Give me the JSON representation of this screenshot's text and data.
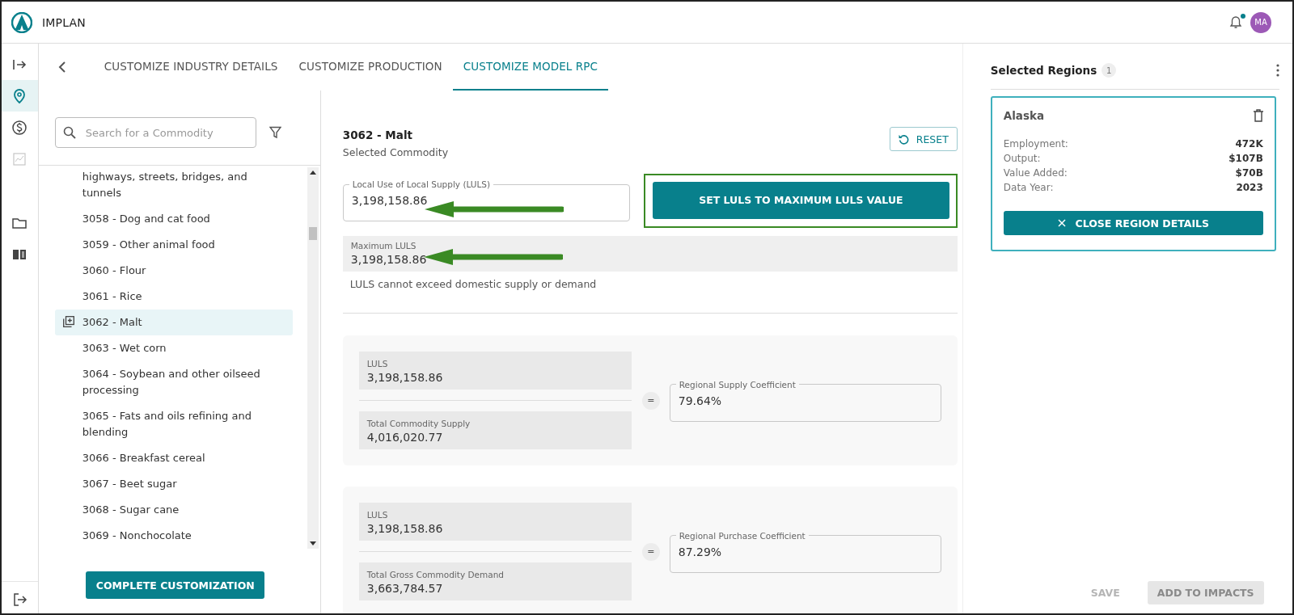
{
  "app": {
    "name": "IMPLAN"
  },
  "header": {
    "notifications_unread": true,
    "avatar": "MA"
  },
  "rail": {
    "items": [
      {
        "kind": "expand",
        "selected": false,
        "disabled": false
      },
      {
        "kind": "location",
        "selected": true,
        "disabled": false
      },
      {
        "kind": "dollar",
        "selected": false,
        "disabled": false
      },
      {
        "kind": "chart",
        "selected": false,
        "disabled": true
      },
      {
        "kind": "folder",
        "selected": false,
        "disabled": false
      },
      {
        "kind": "book",
        "selected": false,
        "disabled": false
      }
    ],
    "bottom": [
      {
        "kind": "logout",
        "selected": false,
        "disabled": false
      }
    ]
  },
  "tabs": [
    {
      "label": "CUSTOMIZE INDUSTRY DETAILS",
      "selected": false
    },
    {
      "label": "CUSTOMIZE PRODUCTION",
      "selected": false
    },
    {
      "label": "CUSTOMIZE MODEL RPC",
      "selected": true
    }
  ],
  "search": {
    "placeholder": "Search for a Commodity"
  },
  "commodities": [
    {
      "label": "highways, streets, bridges, and tunnels",
      "selected": false
    },
    {
      "label": "3058 - Dog and cat food",
      "selected": false
    },
    {
      "label": "3059 - Other animal food",
      "selected": false
    },
    {
      "label": "3060 - Flour",
      "selected": false
    },
    {
      "label": "3061 - Rice",
      "selected": false
    },
    {
      "label": "3062 - Malt",
      "selected": true
    },
    {
      "label": "3063 - Wet corn",
      "selected": false
    },
    {
      "label": "3064 - Soybean and other oilseed processing",
      "selected": false
    },
    {
      "label": "3065 - Fats and oils refining and blending",
      "selected": false
    },
    {
      "label": "3066 - Breakfast cereal",
      "selected": false
    },
    {
      "label": "3067 - Beet sugar",
      "selected": false
    },
    {
      "label": "3068 - Sugar cane",
      "selected": false
    },
    {
      "label": "3069 - Nonchocolate",
      "selected": false
    }
  ],
  "complete_button": "COMPLETE CUSTOMIZATION",
  "selected_commodity": {
    "title": "3062 - Malt",
    "subtitle": "Selected Commodity"
  },
  "reset_button": "RESET",
  "luls_field": {
    "label": "Local Use of Local Supply (LULS)",
    "value": "3,198,158.86",
    "annotated": true
  },
  "set_max_button": {
    "label": "SET LULS TO MAXIMUM LULS VALUE",
    "highlighted": true
  },
  "maximum_luls": {
    "label": "Maximum LULS",
    "value": "3,198,158.86",
    "annotated": true,
    "hint": "LULS cannot exceed domestic supply or demand"
  },
  "equations": [
    {
      "numerator": {
        "label": "LULS",
        "value": "3,198,158.86"
      },
      "denominator": {
        "label": "Total Commodity Supply",
        "value": "4,016,020.77"
      },
      "operator": "=",
      "result": {
        "label": "Regional Supply Coefficient",
        "value": "79.64%"
      }
    },
    {
      "numerator": {
        "label": "LULS",
        "value": "3,198,158.86"
      },
      "denominator": {
        "label": "Total Gross Commodity Demand",
        "value": "3,663,784.57"
      },
      "operator": "=",
      "result": {
        "label": "Regional Purchase Coefficient",
        "value": "87.29%"
      }
    }
  ],
  "selected_regions": {
    "title": "Selected Regions",
    "count": "1",
    "regions": [
      {
        "name": "Alaska",
        "stats": [
          {
            "label": "Employment:",
            "value": "472K"
          },
          {
            "label": "Output:",
            "value": "$107B"
          },
          {
            "label": "Value Added:",
            "value": "$70B"
          },
          {
            "label": "Data Year:",
            "value": "2023"
          }
        ],
        "close_button": "CLOSE REGION DETAILS"
      }
    ]
  },
  "footer_buttons": [
    {
      "label": "SAVE",
      "kind": "text",
      "disabled": true
    },
    {
      "label": "ADD TO IMPACTS",
      "kind": "filled",
      "disabled": true
    }
  ]
}
